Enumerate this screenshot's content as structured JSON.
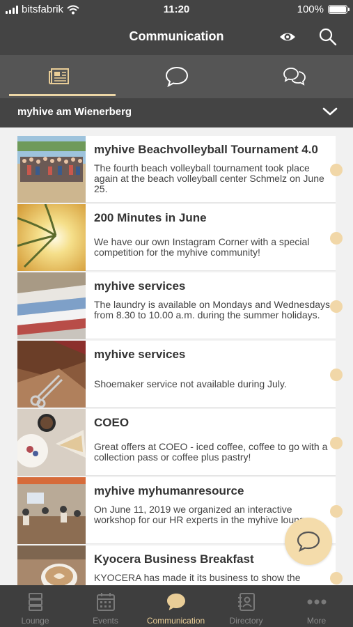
{
  "status_bar": {
    "carrier": "bitsfabrik",
    "time": "11:20",
    "battery": "100%",
    "battery_level": 1.0
  },
  "header": {
    "title": "Communication",
    "icons": [
      "eye-icon",
      "search-icon"
    ]
  },
  "tabs": [
    {
      "icon": "newspaper-icon",
      "active": true
    },
    {
      "icon": "chat-bubble-icon",
      "active": false
    },
    {
      "icon": "group-chat-icon",
      "active": false
    }
  ],
  "channel": {
    "label": "myhive am Wienerberg",
    "icon": "chevron-down-icon"
  },
  "feed": {
    "items": [
      {
        "title": "myhive Beachvolleyball Tournament 4.0",
        "text": "The fourth beach volleyball tournament took place again at the beach volleyball center Schmelz on June 25.",
        "image": "group-photo"
      },
      {
        "title": "200 Minutes in June",
        "text": "We have our own Instagram Corner with a special competition for the myhive community!",
        "image": "sunburst-palm"
      },
      {
        "title": "myhive services",
        "text": "The laundry is available on Mondays and Wednesdays from 8.30 to 10.00 a.m. during the summer holidays.",
        "image": "folded-shirts"
      },
      {
        "title": "myhive services",
        "text": "Shoemaker service not available during July.",
        "image": "leather-scissors"
      },
      {
        "title": "COEO",
        "text": "Great offers at COEO -  iced coffee, coffee to go with a collection pass or coffee plus pastry!",
        "image": "coffee-cake"
      },
      {
        "title": "myhive myhumanresource",
        "text": "On June 11, 2019 we organized an interactive workshop for our HR experts in the myhive lounge.",
        "image": "workshop-room"
      },
      {
        "title": "Kyocera Business Breakfast",
        "text": "KYOCERA has made it its business to show the",
        "image": "latte-cup"
      }
    ]
  },
  "fab": {
    "icon": "chat-bubble-icon"
  },
  "bottom_nav": [
    {
      "label": "Lounge",
      "icon": "stack-icon",
      "active": false
    },
    {
      "label": "Events",
      "icon": "calendar-icon",
      "active": false
    },
    {
      "label": "Communication",
      "icon": "chat-bubble-icon",
      "active": true
    },
    {
      "label": "Directory",
      "icon": "address-book-icon",
      "active": false
    },
    {
      "label": "More",
      "icon": "more-dots-icon",
      "active": false
    }
  ],
  "colors": {
    "header_bg": "#444444",
    "tabs_bg": "#555555",
    "accent": "#ECD6A6",
    "feed_bg": "#F1F1F1",
    "bottom_bar_bg": "#3E3E3E"
  }
}
